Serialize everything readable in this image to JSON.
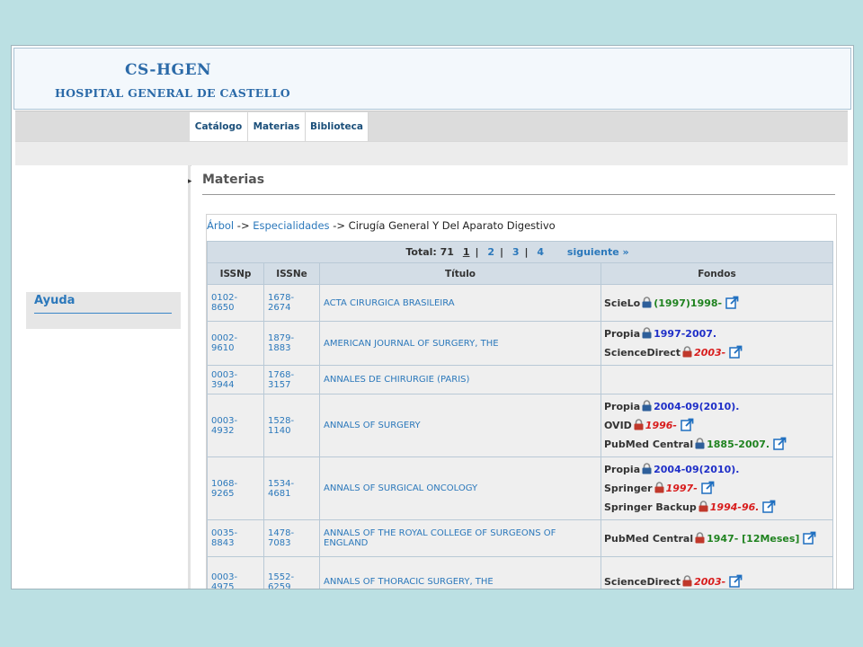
{
  "header": {
    "title": "CS-HGEN",
    "subtitle": "HOSPITAL GENERAL DE CASTELLO"
  },
  "nav": {
    "tabs": [
      "Catálogo",
      "Materias",
      "Biblioteca"
    ]
  },
  "sidebar": {
    "help_label": "Ayuda"
  },
  "page": {
    "title": "Materias"
  },
  "breadcrumb": {
    "root": "Árbol",
    "sep1": "->",
    "level1": "Especialidades",
    "sep2": "->",
    "current": "Cirugía General Y Del Aparato Digestivo"
  },
  "pagination": {
    "total": "Total: 71",
    "pages": [
      "1",
      "2",
      "3",
      "4"
    ],
    "separator": "|",
    "next": "siguiente »"
  },
  "table": {
    "columns": [
      "ISSNp",
      "ISSNe",
      "Título",
      "Fondos"
    ],
    "rows": [
      {
        "issnp": "0102-8650",
        "issne": "1678-2674",
        "title": "ACTA CIRURGICA BRASILEIRA",
        "fondos": [
          {
            "source": "ScieLo",
            "lock": "blue",
            "coverage": "(1997)1998-",
            "color": "green",
            "link": true
          }
        ]
      },
      {
        "issnp": "0002-9610",
        "issne": "1879-1883",
        "title": "AMERICAN JOURNAL OF SURGERY, THE",
        "fondos": [
          {
            "source": "Propia",
            "lock": "blue",
            "coverage": "1997-2007.",
            "color": "blue",
            "link": false
          },
          {
            "source": "ScienceDirect",
            "lock": "red",
            "coverage": "2003-",
            "color": "red",
            "link": true
          }
        ]
      },
      {
        "issnp": "0003-3944",
        "issne": "1768-3157",
        "title": "ANNALES DE CHIRURGIE (PARIS)",
        "fondos": []
      },
      {
        "issnp": "0003-4932",
        "issne": "1528-1140",
        "title": "ANNALS OF SURGERY",
        "fondos": [
          {
            "source": "Propia",
            "lock": "blue",
            "coverage": "2004-09(2010).",
            "color": "blue",
            "link": false
          },
          {
            "source": "OVID",
            "lock": "red",
            "coverage": "1996-",
            "color": "red",
            "link": true
          },
          {
            "source": "PubMed Central",
            "lock": "blue",
            "coverage": "1885-2007.",
            "color": "green",
            "link": true
          }
        ]
      },
      {
        "issnp": "1068-9265",
        "issne": "1534-4681",
        "title": "ANNALS OF SURGICAL ONCOLOGY",
        "fondos": [
          {
            "source": "Propia",
            "lock": "blue",
            "coverage": "2004-09(2010).",
            "color": "blue",
            "link": false
          },
          {
            "source": "Springer",
            "lock": "red",
            "coverage": "1997-",
            "color": "red",
            "link": true
          },
          {
            "source": "Springer Backup",
            "lock": "red",
            "coverage": "1994-96.",
            "color": "red",
            "link": true
          }
        ]
      },
      {
        "issnp": "0035-8843",
        "issne": "1478-7083",
        "title": "ANNALS OF THE ROYAL COLLEGE OF SURGEONS OF ENGLAND",
        "fondos": [
          {
            "source": "PubMed Central",
            "lock": "red",
            "coverage": "1947- [12Meses]",
            "color": "green",
            "link": true
          }
        ]
      },
      {
        "issnp": "0003-4975",
        "issne": "1552-6259",
        "title": "ANNALS OF THORACIC SURGERY, THE",
        "fondos": [
          {
            "source": "ScienceDirect",
            "lock": "red",
            "coverage": "2003-",
            "color": "red",
            "link": true
          }
        ]
      }
    ]
  },
  "colors": {
    "link": "#2b78bb",
    "heading": "#2b6aa8",
    "coverage_blue": "#1f2fc8",
    "coverage_red": "#d81d1d",
    "coverage_green": "#208320",
    "lock_blue": "#2e5f9a",
    "lock_red": "#c0382b"
  }
}
